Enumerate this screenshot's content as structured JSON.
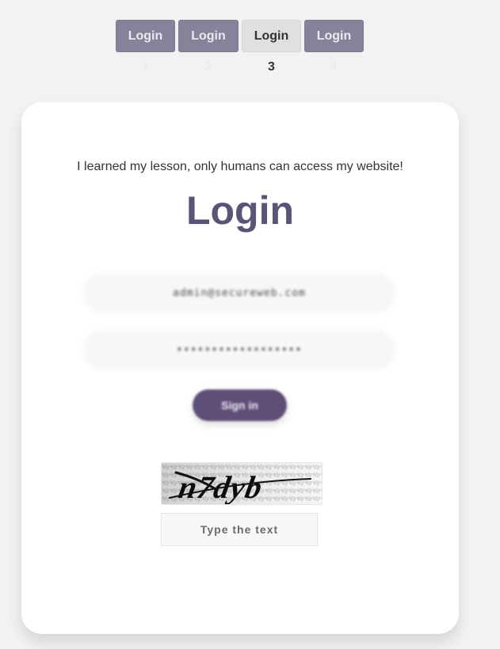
{
  "tabs": [
    {
      "label": "Login 1"
    },
    {
      "label": "Login 2"
    },
    {
      "label": "Login 3"
    },
    {
      "label": "Login 4"
    }
  ],
  "card": {
    "subtitle": "I learned my lesson, only humans can access my website!",
    "title": "Login",
    "fields": {
      "email_value": "admin@secureweb.com",
      "password_value": "••••••••••••••••••"
    },
    "signin_label": "Sign in",
    "captcha": {
      "image_text": "n7dyb",
      "input_placeholder": "Type the text"
    }
  },
  "colors": {
    "page_bg": "#f2f2f2",
    "tab_active_bg": "#e0e0e0",
    "tab_bg": "#878199",
    "title": "#5a5476",
    "signin_bg": "#5e4f77"
  },
  "icons": {
    "captcha_image": "captcha-image"
  }
}
